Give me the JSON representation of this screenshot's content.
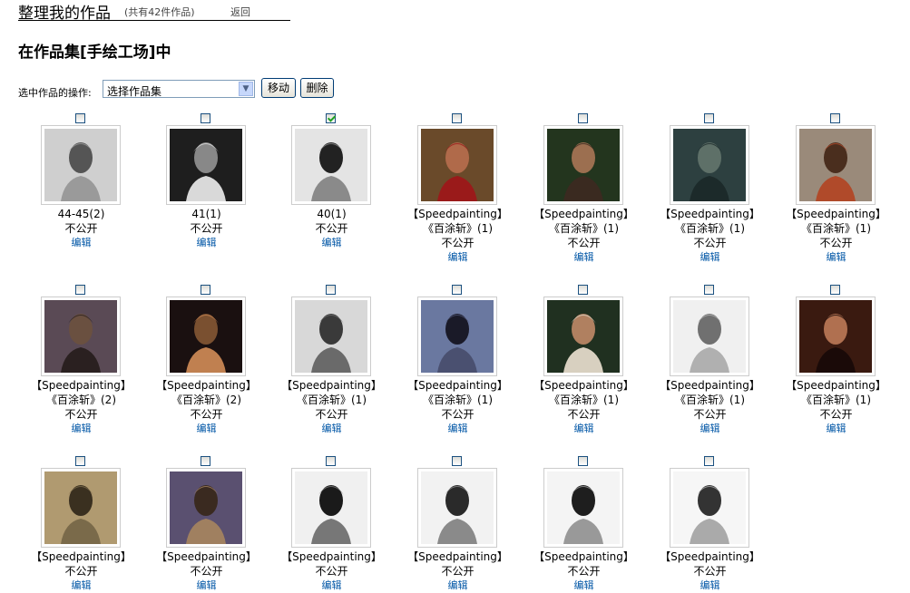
{
  "header": {
    "title": "整理我的作品",
    "count": "(共有42件作品)",
    "back": "返回"
  },
  "collection_title": "在作品集[手绘工场]中",
  "ops": {
    "label": "选中作品的操作:",
    "select_value": "选择作品集",
    "move_label": "移动",
    "delete_label": "删除"
  },
  "labels": {
    "private": "不公开",
    "edit": "编辑"
  },
  "works": [
    {
      "lines": [
        "44-45(2)"
      ],
      "checked": false,
      "palette": [
        "#cfcfcf",
        "#555",
        "#9a9a9a"
      ]
    },
    {
      "lines": [
        "41(1)"
      ],
      "checked": false,
      "palette": [
        "#1e1e1e",
        "#888",
        "#d9d9d9"
      ]
    },
    {
      "lines": [
        "40(1)"
      ],
      "checked": true,
      "palette": [
        "#e4e4e4",
        "#222",
        "#8a8a8a"
      ]
    },
    {
      "lines": [
        "【Speedpainting】",
        "《百涂斩》(1)"
      ],
      "checked": false,
      "palette": [
        "#6a4a2a",
        "#b06a4a",
        "#9a1a1a"
      ]
    },
    {
      "lines": [
        "【Speedpainting】",
        "《百涂斩》(1)"
      ],
      "checked": false,
      "palette": [
        "#23351e",
        "#9c6f50",
        "#3a2a20"
      ]
    },
    {
      "lines": [
        "【Speedpainting】",
        "《百涂斩》(1)"
      ],
      "checked": false,
      "palette": [
        "#2d4040",
        "#5e7068",
        "#1c2a2a"
      ]
    },
    {
      "lines": [
        "【Speedpainting】",
        "《百涂斩》(1)"
      ],
      "checked": false,
      "palette": [
        "#9a8a7a",
        "#4a2e1e",
        "#b04a2a"
      ]
    },
    {
      "lines": [
        "【Speedpainting】",
        "《百涂斩》(2)"
      ],
      "checked": false,
      "palette": [
        "#5a4a55",
        "#6a5040",
        "#2a2020"
      ]
    },
    {
      "lines": [
        "【Speedpainting】",
        "《百涂斩》(2)"
      ],
      "checked": false,
      "palette": [
        "#1a1010",
        "#7a5030",
        "#c08050"
      ]
    },
    {
      "lines": [
        "【Speedpainting】",
        "《百涂斩》(1)"
      ],
      "checked": false,
      "palette": [
        "#d8d8d8",
        "#3a3a3a",
        "#6a6a6a"
      ]
    },
    {
      "lines": [
        "【Speedpainting】",
        "《百涂斩》(1)"
      ],
      "checked": false,
      "palette": [
        "#6a78a0",
        "#1a1a28",
        "#4a5070"
      ]
    },
    {
      "lines": [
        "【Speedpainting】",
        "《百涂斩》(1)"
      ],
      "checked": false,
      "palette": [
        "#203020",
        "#b08060",
        "#d8d0c0"
      ]
    },
    {
      "lines": [
        "【Speedpainting】",
        "《百涂斩》(1)"
      ],
      "checked": false,
      "palette": [
        "#f0f0f0",
        "#707070",
        "#b0b0b0"
      ]
    },
    {
      "lines": [
        "【Speedpainting】",
        "《百涂斩》(1)"
      ],
      "checked": false,
      "palette": [
        "#3a1a10",
        "#b07050",
        "#1a0a08"
      ]
    },
    {
      "lines": [
        "【Speedpainting】"
      ],
      "checked": false,
      "palette": [
        "#b09a70",
        "#3a3020",
        "#7a6a4a"
      ]
    },
    {
      "lines": [
        "【Speedpainting】"
      ],
      "checked": false,
      "palette": [
        "#5a5070",
        "#3a2a20",
        "#a08060"
      ]
    },
    {
      "lines": [
        "【Speedpainting】"
      ],
      "checked": false,
      "palette": [
        "#f0f0f0",
        "#1a1a1a",
        "#777"
      ]
    },
    {
      "lines": [
        "【Speedpainting】"
      ],
      "checked": false,
      "palette": [
        "#f2f2f2",
        "#2a2a2a",
        "#8a8a8a"
      ]
    },
    {
      "lines": [
        "【Speedpainting】"
      ],
      "checked": false,
      "palette": [
        "#f4f4f4",
        "#1e1e1e",
        "#999"
      ]
    },
    {
      "lines": [
        "【Speedpainting】"
      ],
      "checked": false,
      "palette": [
        "#f6f6f6",
        "#333",
        "#aaa"
      ]
    }
  ]
}
